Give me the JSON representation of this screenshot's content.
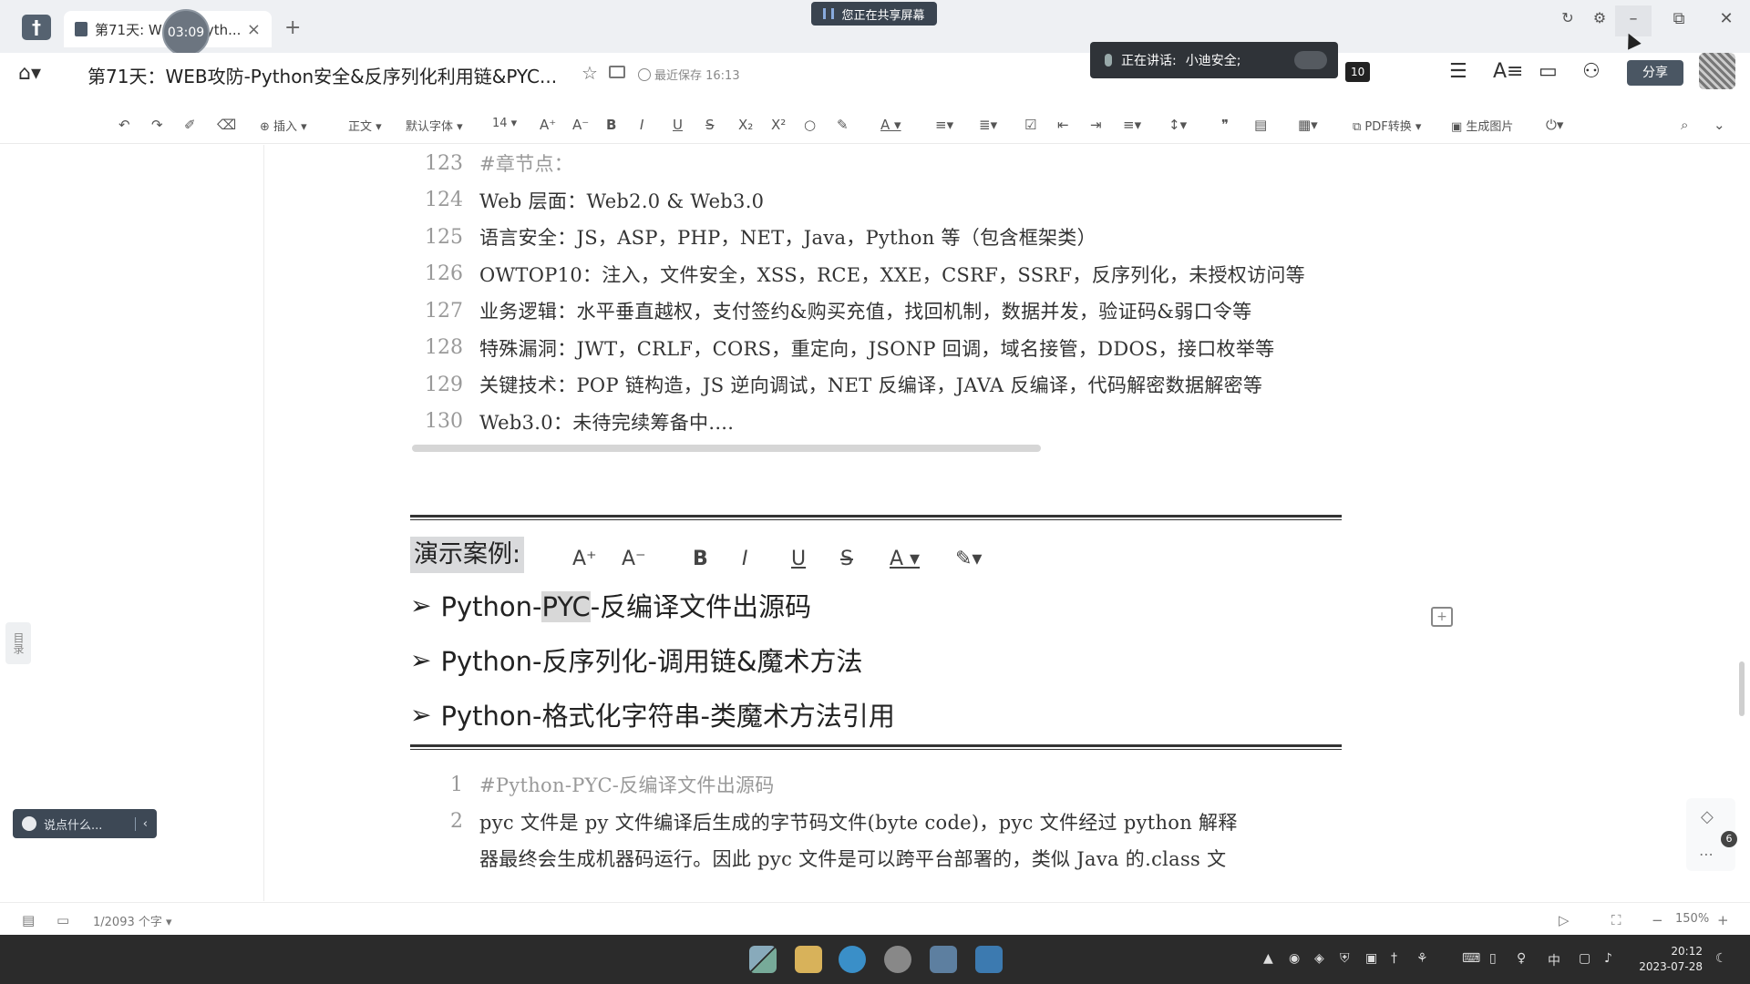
{
  "tab": {
    "title": "第71天: W",
    "title_tail": "'yth...",
    "timer": "03:09",
    "close": "×",
    "new": "+"
  },
  "share_banner": "您正在共享屏幕",
  "doc": {
    "title": "第71天：WEB攻防-Python安全&反序列化利用链&PYC...",
    "saved": "最近保存 16:13"
  },
  "speaking": {
    "label": "正在讲话:",
    "name": "小迪安全;"
  },
  "badge_count": "10",
  "share_button": "分享",
  "toolbar": {
    "insert": "插入",
    "style": "正文",
    "font": "默认字体",
    "size": "14",
    "pdf": "PDF转换",
    "image": "生成图片"
  },
  "outline": "目录",
  "comment_box": {
    "placeholder": "说点什么..."
  },
  "code_lines_top": [
    {
      "num": "123",
      "text": "#章节点：",
      "comment": true
    },
    {
      "num": "124",
      "text": "Web 层面：Web2.0 & Web3.0",
      "comment": false
    },
    {
      "num": "125",
      "text": "语言安全：JS，ASP，PHP，NET，Java，Python 等（包含框架类）",
      "comment": false
    },
    {
      "num": "126",
      "text": "OWTOP10：注入，文件安全，XSS，RCE，XXE，CSRF，SSRF，反序列化，未授权访问等",
      "comment": false
    },
    {
      "num": "127",
      "text": "业务逻辑：水平垂直越权，支付签约&购买充值，找回机制，数据并发，验证码&弱口令等",
      "comment": false
    },
    {
      "num": "128",
      "text": "特殊漏洞：JWT，CRLF，CORS，重定向，JSONP 回调，域名接管，DDOS，接口枚举等",
      "comment": false
    },
    {
      "num": "129",
      "text": "关键技术：POP 链构造，JS 逆向调试，NET 反编译，JAVA 反编译，代码解密数据解密等",
      "comment": false
    },
    {
      "num": "130",
      "text": "Web3.0：未待完续筹备中....",
      "comment": false
    }
  ],
  "demo": {
    "title": "演示案例:",
    "items": [
      {
        "pre": "Python-",
        "hl": "PYC",
        "post": "-反编译文件出源码"
      },
      {
        "pre": "Python-反序列化-调用链&魔术方法",
        "hl": "",
        "post": ""
      },
      {
        "pre": "Python-格式化字符串-类魔术方法引用",
        "hl": "",
        "post": ""
      }
    ]
  },
  "code_lines_bottom": [
    {
      "num": "1",
      "text": "#Python-PYC-反编译文件出源码",
      "comment": true
    },
    {
      "num": "2",
      "text": "pyc 文件是 py 文件编译后生成的字节码文件(byte code)，pyc 文件经过 python 解释",
      "comment": false
    },
    {
      "num": "",
      "text": "器最终会生成机器码运行。因此 pyc 文件是可以跨平台部署的，类似 Java 的.class 文",
      "comment": false
    }
  ],
  "status": {
    "words": "1/2093 个字",
    "zoom": "150%"
  },
  "side_count": "6",
  "taskbar": {
    "ime": "中",
    "time": "20:12",
    "date": "2023-07-28"
  },
  "colors": {
    "accent": "#4a5663",
    "taskbar": "#2b2b2b",
    "highlight": "#d8d8d8"
  }
}
